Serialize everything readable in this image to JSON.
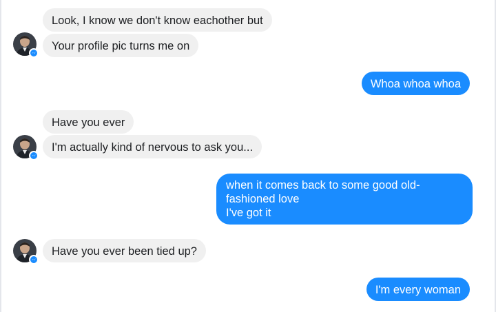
{
  "conversation": {
    "messages": [
      {
        "sender": "them",
        "text": "Look, I know we don't know eachother but"
      },
      {
        "sender": "them",
        "text": "Your profile pic turns me on"
      },
      {
        "sender": "me",
        "text": "Whoa whoa whoa"
      },
      {
        "sender": "them",
        "text": "Have you ever"
      },
      {
        "sender": "them",
        "text": "I'm actually kind of nervous to ask you..."
      },
      {
        "sender": "me",
        "lines": [
          "when it comes back to some good old-",
          "fashioned love",
          "I've got it"
        ]
      },
      {
        "sender": "them",
        "text": "Have you ever been tied up?"
      },
      {
        "sender": "me",
        "text": "I'm every woman"
      }
    ]
  },
  "colors": {
    "incoming_bubble": "#f0f0f0",
    "outgoing_bubble": "#1a8cff",
    "badge": "#1a8cff"
  },
  "icons": {
    "avatar": "avatar",
    "badge": "messenger-badge-icon"
  }
}
